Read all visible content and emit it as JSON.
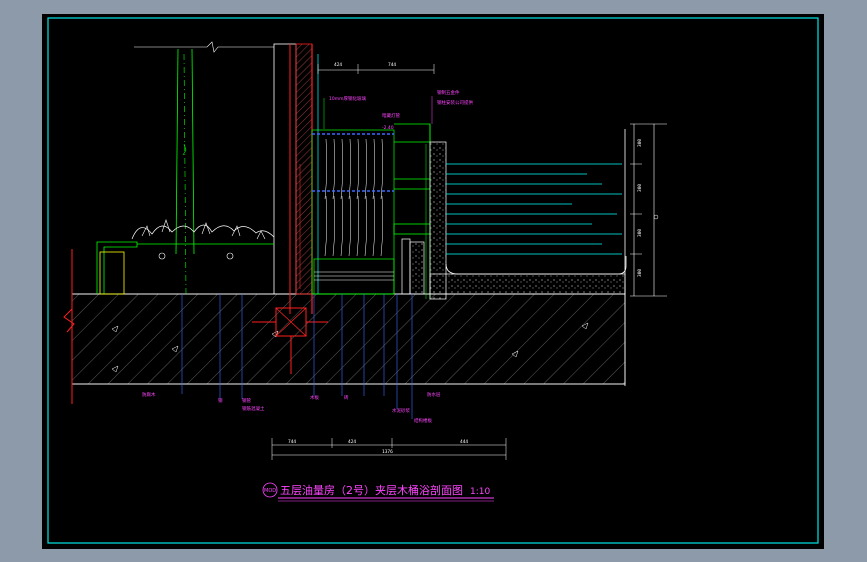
{
  "drawing": {
    "title": "五层油量房（2号）夹层木桶浴剖面图",
    "scale": "1:10",
    "title_badge": "MOD.",
    "dimensions_top": [
      "424",
      "744"
    ],
    "dimensions_bottom": [
      "744",
      "424",
      "444"
    ],
    "dimension_bottom_total": "1376",
    "dimensions_right": [
      "300",
      "300",
      "300",
      "300"
    ],
    "annotations": {
      "top_a": "10mm厚钢化玻璃",
      "top_b": "暗藏灯管",
      "top_c": "钢制五金件",
      "top_d": "钢柱安装公司提供",
      "water_level": "-2.40",
      "bottom_1": "防腐木",
      "bottom_2": "钢",
      "bottom_3": "钢管",
      "bottom_4": "钢筋混凝土",
      "bottom_5": "木板",
      "bottom_6": "砖",
      "bottom_7": "防水层",
      "bottom_8": "水泥砂浆",
      "bottom_9": "结构楼板"
    }
  },
  "colors": {
    "frame": "#00e5e5",
    "magenta": "#ff44ff",
    "green": "#00ff00",
    "blue": "#3a6bff",
    "red": "#ff2020",
    "white": "#ffffff",
    "cyan": "#00ffff",
    "yellow": "#ffff00"
  }
}
